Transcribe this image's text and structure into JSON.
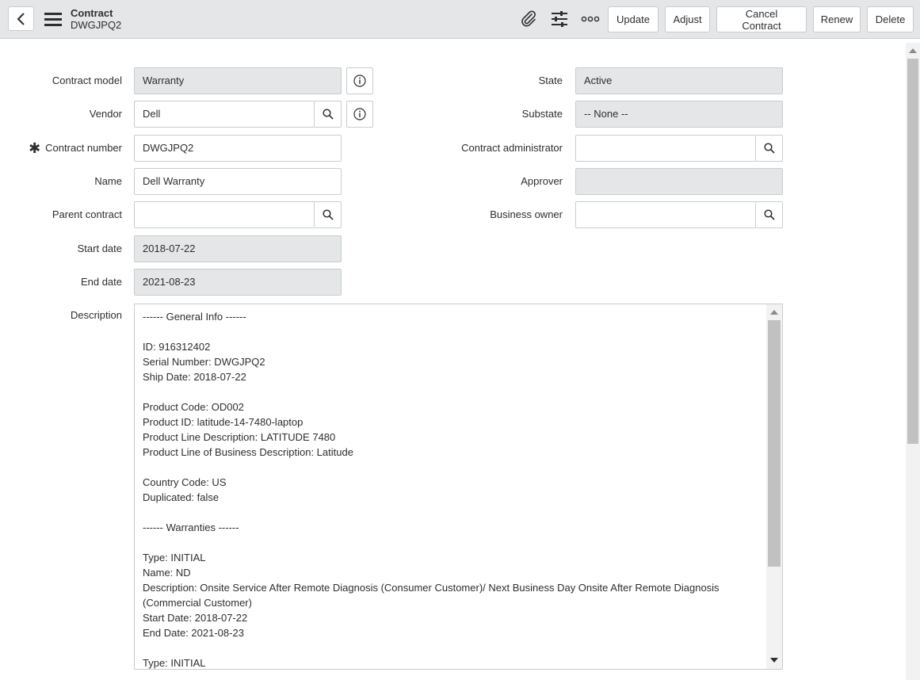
{
  "header": {
    "title": "Contract",
    "subtitle": "DWGJPQ2",
    "icons": [
      "back-icon",
      "hamburger-menu-icon",
      "paperclip-icon",
      "sliders-icon",
      "more-options-icon"
    ],
    "buttons": {
      "update": "Update",
      "adjust": "Adjust",
      "cancel_contract": "Cancel Contract",
      "renew": "Renew",
      "delete": "Delete"
    }
  },
  "form": {
    "contract_model": {
      "label": "Contract model",
      "value": "Warranty"
    },
    "vendor": {
      "label": "Vendor",
      "value": "Dell"
    },
    "contract_number": {
      "label": "Contract number",
      "value": "DWGJPQ2",
      "required_mark": "✱"
    },
    "name": {
      "label": "Name",
      "value": "Dell Warranty"
    },
    "parent_contract": {
      "label": "Parent contract",
      "value": ""
    },
    "start_date": {
      "label": "Start date",
      "value": "2018-07-22"
    },
    "end_date": {
      "label": "End date",
      "value": "2021-08-23"
    },
    "state": {
      "label": "State",
      "value": "Active"
    },
    "substate": {
      "label": "Substate",
      "value": "-- None --"
    },
    "contract_administrator": {
      "label": "Contract administrator",
      "value": ""
    },
    "approver": {
      "label": "Approver",
      "value": ""
    },
    "business_owner": {
      "label": "Business owner",
      "value": ""
    },
    "description": {
      "label": "Description",
      "value": "------ General Info ------\n\nID: 916312402\nSerial Number: DWGJPQ2\nShip Date: 2018-07-22\n\nProduct Code: OD002\nProduct ID: latitude-14-7480-laptop\nProduct Line Description: LATITUDE 7480\nProduct Line of Business Description: Latitude\n\nCountry Code: US\nDuplicated: false\n\n------ Warranties ------\n\nType: INITIAL\nName: ND\nDescription: Onsite Service After Remote Diagnosis (Consumer Customer)/ Next Business Day Onsite After Remote Diagnosis (Commercial Customer)\nStart Date: 2018-07-22\nEnd Date: 2021-08-23\n\nType: INITIAL"
    }
  },
  "colors": {
    "header_bg": "#e4e6e7",
    "readonly_bg": "#e4e6e7",
    "border": "#c9ccce",
    "text": "#2e2e2e"
  }
}
